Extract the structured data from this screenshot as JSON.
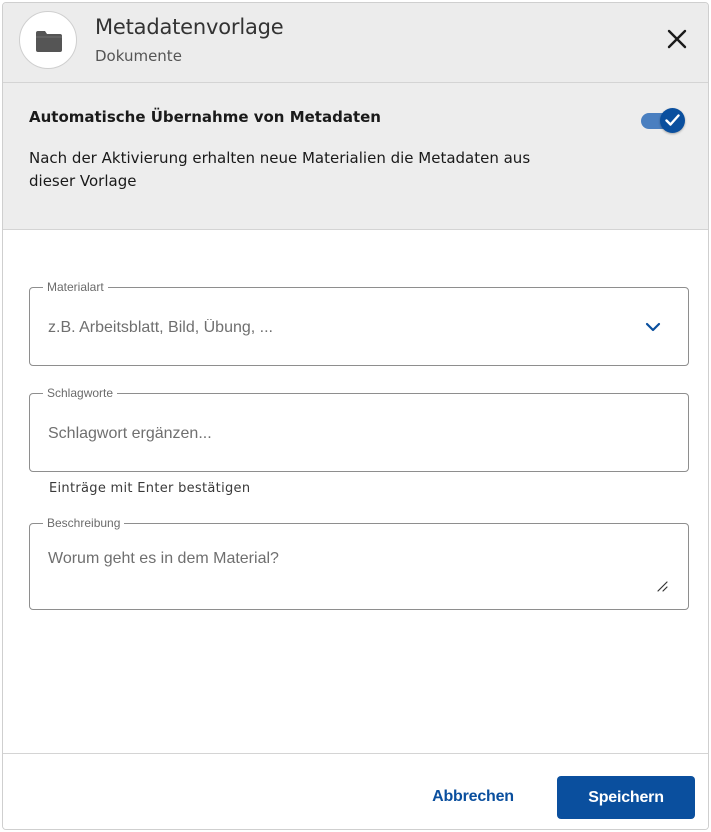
{
  "header": {
    "title": "Metadatenvorlage",
    "subtitle": "Dokumente",
    "icon": "folder-icon",
    "close_icon": "close-icon"
  },
  "auto_import": {
    "title": "Automatische Übernahme von Metadaten",
    "description": "Nach der Aktivierung erhalten neue Materialien die Metadaten aus dieser Vorlage",
    "enabled": true
  },
  "form": {
    "material_type": {
      "label": "Materialart",
      "placeholder": "z.B. Arbeitsblatt, Bild, Übung, ..."
    },
    "keywords": {
      "label": "Schlagworte",
      "placeholder": "Schlagwort ergänzen...",
      "hint": "Einträge mit Enter bestätigen"
    },
    "description": {
      "label": "Beschreibung",
      "placeholder": "Worum geht es in dem Material?"
    }
  },
  "footer": {
    "cancel_label": "Abbrechen",
    "save_label": "Speichern"
  },
  "colors": {
    "primary": "#0a4f9e",
    "toggle_track": "#4a7fc0",
    "header_bg": "#ececec"
  }
}
